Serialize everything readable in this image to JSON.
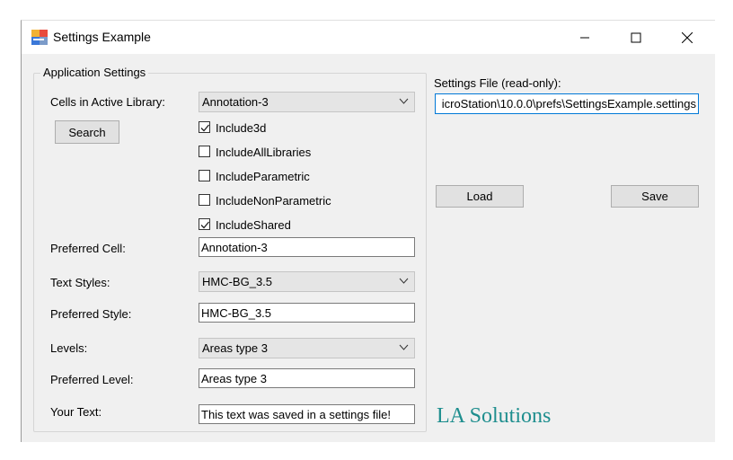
{
  "window": {
    "title": "Settings Example",
    "icon": "app-icon"
  },
  "group": {
    "legend": "Application Settings",
    "cells_label": "Cells in Active Library:",
    "cells_value": "Annotation-3",
    "search_label": "Search",
    "checkboxes": [
      {
        "label": "Include3d",
        "checked": true
      },
      {
        "label": "IncludeAllLibraries",
        "checked": false
      },
      {
        "label": "IncludeParametric",
        "checked": false
      },
      {
        "label": "IncludeNonParametric",
        "checked": false
      },
      {
        "label": "IncludeShared",
        "checked": true
      }
    ],
    "preferred_cell_label": "Preferred Cell:",
    "preferred_cell_value": "Annotation-3",
    "text_styles_label": "Text Styles:",
    "text_styles_value": "HMC-BG_3.5",
    "preferred_style_label": "Preferred Style:",
    "preferred_style_value": "HMC-BG_3.5",
    "levels_label": "Levels:",
    "levels_value": "Areas type 3",
    "preferred_level_label": "Preferred Level:",
    "preferred_level_value": "Areas type 3",
    "your_text_label": "Your Text:",
    "your_text_value": "This text was saved in a settings file!"
  },
  "settings_file": {
    "label": "Settings File (read-only):",
    "value": "icroStation\\10.0.0\\prefs\\SettingsExample.settings",
    "load_label": "Load",
    "save_label": "Save"
  },
  "logo": {
    "text": "LA Solutions",
    "color": "#1e8e8e"
  }
}
